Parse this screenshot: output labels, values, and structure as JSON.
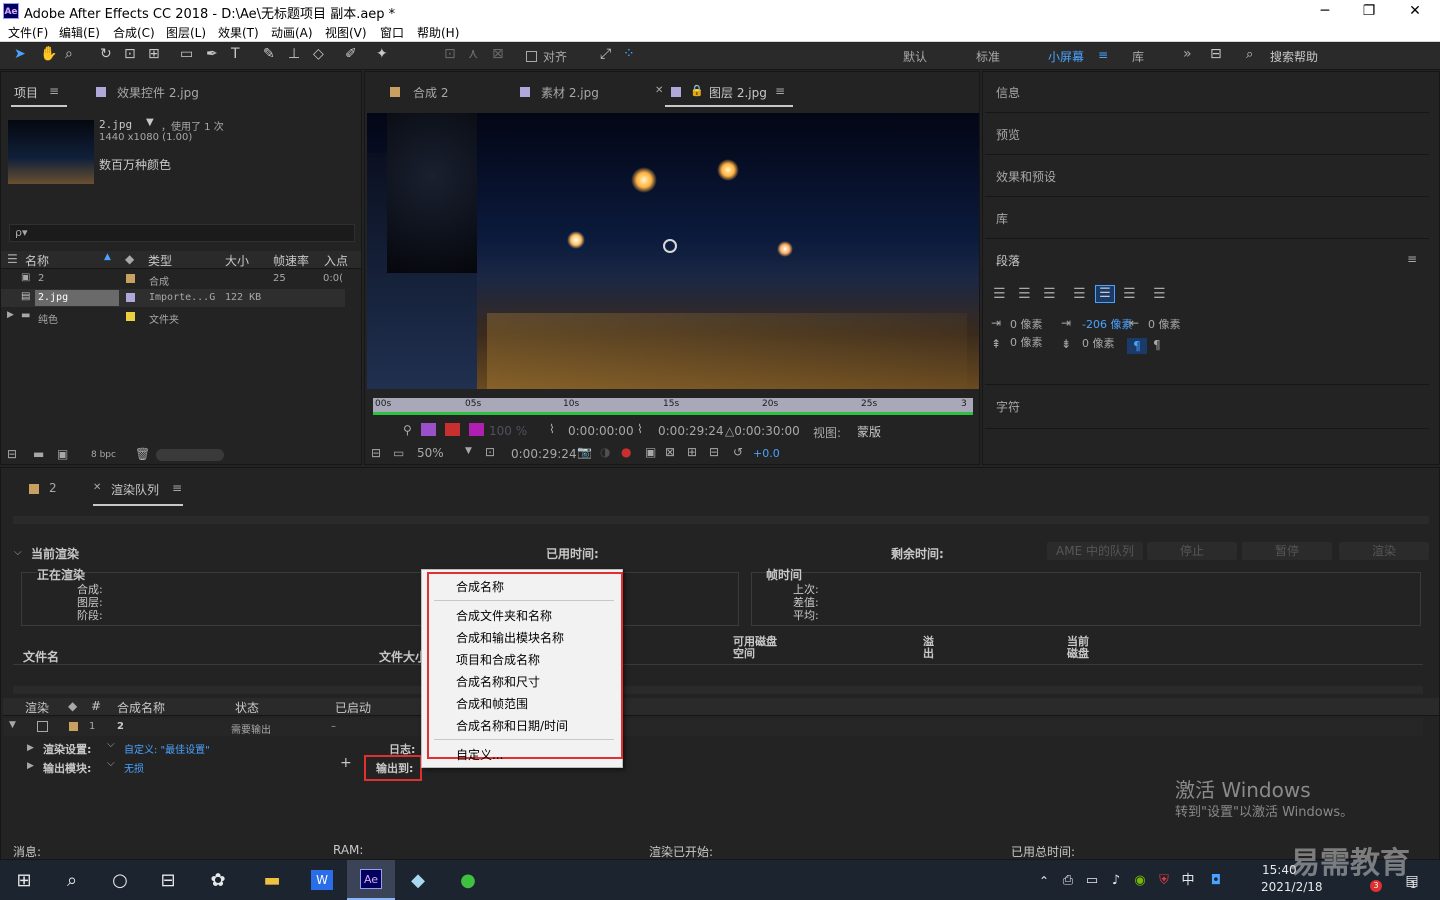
{
  "window": {
    "title": "Adobe After Effects CC 2018 - D:\\Ae\\无标题项目 副本.aep *",
    "logo": "Ae",
    "minimize": "─",
    "maximize": "❐",
    "close": "✕"
  },
  "menu": [
    "文件(F)",
    "编辑(E)",
    "合成(C)",
    "图层(L)",
    "效果(T)",
    "动画(A)",
    "视图(V)",
    "窗口",
    "帮助(H)"
  ],
  "toolbar": {
    "snap_label": "对齐",
    "workspaces": [
      "默认",
      "标准",
      "小屏幕",
      "库"
    ],
    "more": "»",
    "search_placeholder": "搜索帮助"
  },
  "project_panel": {
    "tab_project": "项目",
    "tab_effects": "效果控件 2.jpg",
    "file_name": "2.jpg",
    "usage": "，使用了 1 次",
    "dimensions": "1440 x1080 (1.00)",
    "color": "数百万种颜色",
    "search_icon_text": "ρ▾",
    "columns": [
      "名称",
      "类型",
      "大小",
      "帧速率",
      "入点"
    ],
    "rows": [
      {
        "name": "2",
        "type": "合成",
        "size": "",
        "fps": "25",
        "in": "0:0(",
        "color": "#c8a060"
      },
      {
        "name": "2.jpg",
        "type": "Importe...G",
        "size": "122 KB",
        "fps": "",
        "in": "",
        "color": "#b0a8d8"
      },
      {
        "name": "纯色",
        "type": "文件夹",
        "size": "",
        "fps": "",
        "in": "",
        "color": "#e8d040"
      }
    ],
    "bpc": "8 bpc"
  },
  "viewer": {
    "tabs": [
      "合成 2",
      "素材 2.jpg",
      "图层 2.jpg"
    ],
    "ruler": [
      "00s",
      "05s",
      "10s",
      "15s",
      "20s",
      "25s",
      "3"
    ],
    "opacity": "100 %",
    "time_in": "0:00:00:00",
    "time_out": "0:00:29:24",
    "duration": "△0:00:30:00",
    "view_label": "视图:",
    "view_value": "蒙版",
    "zoom": "50%",
    "current_time": "0:00:29:24",
    "exposure": "+0.0"
  },
  "right_panels": {
    "info": "信息",
    "preview": "预览",
    "effects": "效果和预设",
    "library": "库",
    "paragraph": "段落",
    "character": "字符",
    "indent_left": "0 像素",
    "indent_right": "0 像素",
    "first_indent": "-206 像素",
    "space_before": "0 像素",
    "space_after": "0 像素"
  },
  "render": {
    "tab_comp": "2",
    "tab_queue": "渲染队列",
    "current": "当前渲染",
    "elapsed": "已用时间:",
    "remaining": "剩余时间:",
    "buttons": [
      "AME 中的队列",
      "停止",
      "暂停",
      "渲染"
    ],
    "rendering": "正在渲染",
    "lbl_comp": "合成:",
    "lbl_layer": "图层:",
    "lbl_stage": "阶段:",
    "frame_time": "帧时间",
    "last": "上次:",
    "diff": "差值:",
    "avg": "平均:",
    "filename": "文件名",
    "filesize": "文件大小",
    "disk": "可用磁盘空间",
    "overflow": "溢出",
    "current_disk": "当前磁盘",
    "cols": [
      "渲染",
      "#",
      "合成名称",
      "状态",
      "已启动"
    ],
    "item_num": "1",
    "item_name": "2",
    "item_status": "需要输出",
    "item_started": "–",
    "render_settings_lbl": "渲染设置:",
    "render_settings_val": "自定义: \"最佳设置\"",
    "log_lbl": "日志:",
    "output_module_lbl": "输出模块:",
    "output_module_val": "无损",
    "output_to_lbl": "输出到:",
    "plus": "+",
    "status_msg": "消息:",
    "status_ram": "RAM:",
    "status_started": "渲染已开始:",
    "status_total": "已用总时间:"
  },
  "context_menu": [
    "合成名称",
    "合成文件夹和名称",
    "合成和输出模块名称",
    "项目和合成名称",
    "合成名称和尺寸",
    "合成和帧范围",
    "合成名称和日期/时间",
    "自定义..."
  ],
  "watermark": {
    "line1": "激活 Windows",
    "line2": "转到\"设置\"以激活 Windows。",
    "brand": "易需教育"
  },
  "taskbar": {
    "time": "15:40",
    "date": "2021/2/18",
    "ime": "中",
    "notif": "3",
    "notif2": "1"
  }
}
